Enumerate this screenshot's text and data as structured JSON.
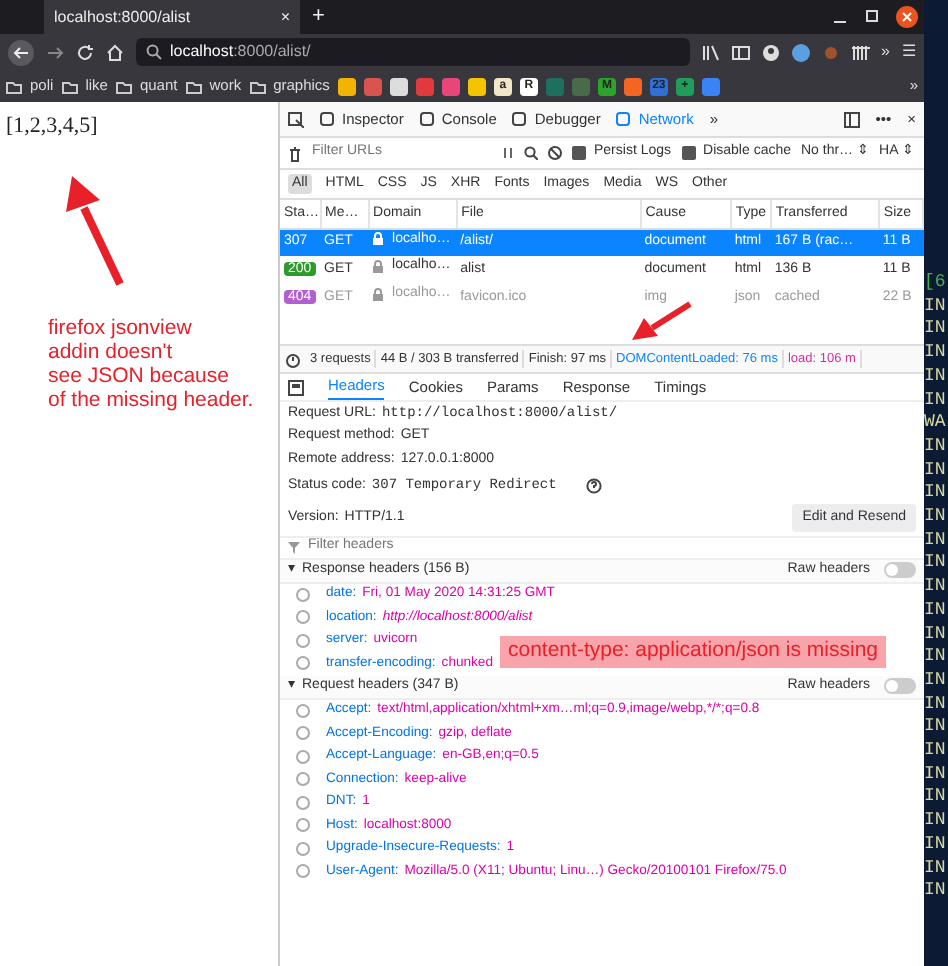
{
  "browser": {
    "tab_title": "localhost:8000/alist",
    "tab_close": "×",
    "new_tab": "+",
    "url_host": "localhost",
    "url_rest": ":8000/alist/",
    "toolbar_more": "»",
    "menu": "☰"
  },
  "bookmarks": {
    "folders": [
      "poli",
      "like",
      "quant",
      "work",
      "graphics"
    ],
    "icons": [
      {
        "color": "#f2b400"
      },
      {
        "color": "#d9534f"
      },
      {
        "color": "#dddddd"
      },
      {
        "color": "#e0393e"
      },
      {
        "color": "#e8457a"
      },
      {
        "color": "#f5c400"
      },
      {
        "color": "#f0e6c8",
        "label": "a"
      },
      {
        "color": "#ffffff",
        "label": "R"
      },
      {
        "color": "#1f6f5f"
      },
      {
        "color": "#4a6b4a"
      },
      {
        "color": "#2aa52a",
        "label": "M"
      },
      {
        "color": "#f26522"
      },
      {
        "color": "#2f6fd6",
        "label": "23"
      },
      {
        "color": "#1e9e5a",
        "label": "+"
      },
      {
        "color": "#3b82f6"
      }
    ],
    "more": "»"
  },
  "page": {
    "body_text": "[1,2,3,4,5]"
  },
  "devtools": {
    "tools": [
      {
        "label": "Inspector",
        "selected": false
      },
      {
        "label": "Console",
        "selected": false
      },
      {
        "label": "Debugger",
        "selected": false
      },
      {
        "label": "Network",
        "selected": true
      }
    ],
    "tools_more": "»",
    "options": "•••",
    "close": "×",
    "filter_placeholder": "Filter URLs",
    "checkboxes": [
      {
        "label": "Persist Logs",
        "checked": false
      },
      {
        "label": "Disable cache",
        "checked": false
      }
    ],
    "selects": [
      "No thr… ⇕",
      "HA ⇕"
    ],
    "type_filters": [
      {
        "label": "All",
        "selected": true
      },
      {
        "label": "HTML",
        "selected": false
      },
      {
        "label": "CSS",
        "selected": false
      },
      {
        "label": "JS",
        "selected": false
      },
      {
        "label": "XHR",
        "selected": false
      },
      {
        "label": "Fonts",
        "selected": false
      },
      {
        "label": "Images",
        "selected": false
      },
      {
        "label": "Media",
        "selected": false
      },
      {
        "label": "WS",
        "selected": false
      },
      {
        "label": "Other",
        "selected": false
      }
    ],
    "columns": [
      "Sta…",
      "Me…",
      "Domain",
      "File",
      "Cause",
      "Type",
      "Transferred",
      "Size"
    ],
    "rows": [
      {
        "status": "307",
        "method": "GET",
        "domain": "localho…",
        "file": "/alist/",
        "cause": "document",
        "type": "html",
        "transferred": "167 B (rac…",
        "size": "11 B",
        "selected": true,
        "dimmed": false
      },
      {
        "status": "200",
        "color": "#2c9b2c",
        "method": "GET",
        "domain": "localho…",
        "file": "alist",
        "cause": "document",
        "type": "html",
        "transferred": "136 B",
        "size": "11 B",
        "selected": false,
        "dimmed": false
      },
      {
        "status": "404",
        "color": "#b45fd0",
        "method": "GET",
        "domain": "localho…",
        "file": "favicon.ico",
        "cause": "img",
        "type": "json",
        "transferred": "cached",
        "size": "22 B",
        "selected": false,
        "dimmed": true
      }
    ],
    "summary": [
      {
        "kind": "plain",
        "text": "3 requests"
      },
      {
        "kind": "plain",
        "text": "44 B / 303 B transferred"
      },
      {
        "kind": "plain",
        "text": "Finish: 97 ms"
      },
      {
        "kind": "dom",
        "text": "DOMContentLoaded: 76 ms"
      },
      {
        "kind": "load",
        "text": "load: 106 m"
      }
    ],
    "detail_tabs": [
      {
        "label": "Headers",
        "selected": true
      },
      {
        "label": "Cookies",
        "selected": false
      },
      {
        "label": "Params",
        "selected": false
      },
      {
        "label": "Response",
        "selected": false
      },
      {
        "label": "Timings",
        "selected": false
      }
    ],
    "fields": [
      {
        "label": "Request URL:",
        "value": "http://localhost:8000/alist/",
        "kind": "mono"
      },
      {
        "label": "Request method:",
        "value": "GET",
        "kind": "plain"
      },
      {
        "label": "Remote address:",
        "value": "127.0.0.1:8000",
        "kind": "plain"
      },
      {
        "label": "Status code:",
        "value": "307 Temporary Redirect",
        "kind": "status"
      },
      {
        "label": "Version:",
        "value": "HTTP/1.1",
        "kind": "version"
      }
    ],
    "resend": "Edit and Resend",
    "headers_placeholder": "Filter headers",
    "sections": [
      {
        "title": "Response headers (156 B)",
        "arrow": "▾",
        "expanded": true,
        "raw_label": "Raw headers",
        "raw_on": false,
        "headers": [
          {
            "name": "date:",
            "value": "Fri, 01 May 2020 14:31:25 GMT",
            "kind": "text"
          },
          {
            "name": "location:",
            "value": "http://localhost:8000/alist",
            "kind": "link"
          },
          {
            "name": "server:",
            "value": "uvicorn",
            "kind": "text"
          },
          {
            "name": "transfer-encoding:",
            "value": "chunked",
            "kind": "text"
          }
        ]
      },
      {
        "title": "Request headers (347 B)",
        "arrow": "▾",
        "expanded": true,
        "raw_label": "Raw headers",
        "raw_on": false,
        "headers": [
          {
            "name": "Accept:",
            "value": "text/html,application/xhtml+xm…ml;q=0.9,image/webp,*/*;q=0.8",
            "kind": "text"
          },
          {
            "name": "Accept-Encoding:",
            "value": "gzip, deflate",
            "kind": "text"
          },
          {
            "name": "Accept-Language:",
            "value": "en-GB,en;q=0.5",
            "kind": "text"
          },
          {
            "name": "Connection:",
            "value": "keep-alive",
            "kind": "text"
          },
          {
            "name": "DNT:",
            "value": "1",
            "kind": "text"
          },
          {
            "name": "Host:",
            "value": "localhost:8000",
            "kind": "text"
          },
          {
            "name": "Upgrade-Insecure-Requests:",
            "value": "1",
            "kind": "text"
          },
          {
            "name": "User-Agent:",
            "value": "Mozilla/5.0 (X11; Ubuntu; Linu…) Gecko/20100101 Firefox/75.0",
            "kind": "text"
          }
        ]
      }
    ]
  },
  "terminal": {
    "lines": [
      "[6",
      "IN",
      "IN",
      "IN",
      "IN",
      "IN",
      "WA",
      "IN",
      "IN",
      "IN",
      "IN",
      "IN",
      "IN",
      "IN",
      "IN",
      "IN",
      "IN",
      "IN",
      "IN",
      "IN",
      "IN",
      "IN",
      "IN",
      "IN",
      "IN",
      "IN",
      "IN"
    ]
  },
  "annotations": {
    "note_lines": [
      "firefox jsonview",
      "addin doesn't",
      "see JSON because",
      "of the missing header."
    ],
    "callout": "content-type: application/json is missing"
  }
}
